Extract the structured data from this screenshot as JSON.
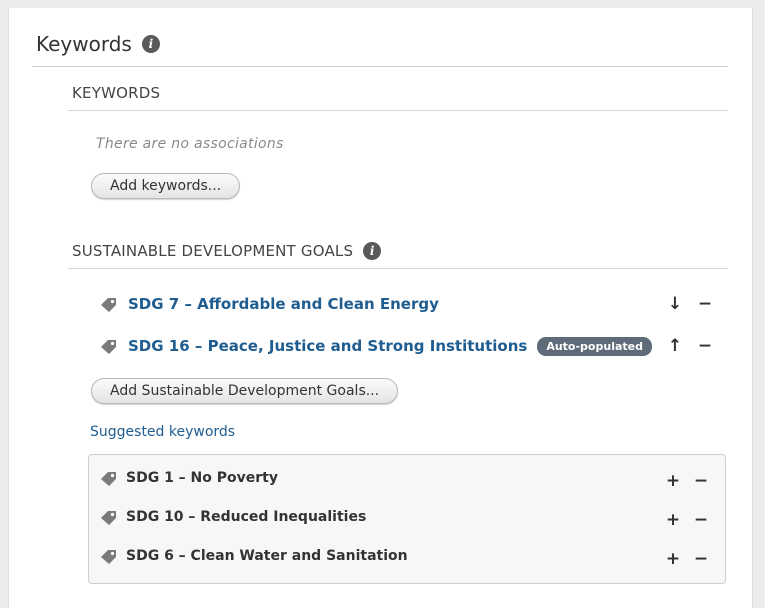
{
  "section": {
    "title": "Keywords",
    "info_icon": "info-icon"
  },
  "keywords": {
    "heading": "KEYWORDS",
    "empty_message": "There are no associations",
    "add_button": "Add keywords..."
  },
  "sdg": {
    "heading": "SUSTAINABLE DEVELOPMENT GOALS",
    "info_icon": "info-icon",
    "items": [
      {
        "label": "SDG 7 – Affordable and Clean Energy",
        "badge": "",
        "move_icon": "arrow-down-icon",
        "remove_icon": "minus-icon"
      },
      {
        "label": "SDG 16 – Peace, Justice and Strong Institutions",
        "badge": "Auto-populated",
        "move_icon": "arrow-up-icon",
        "remove_icon": "minus-icon"
      }
    ],
    "add_button": "Add Sustainable Development Goals..."
  },
  "suggested": {
    "label": "Suggested keywords",
    "items": [
      {
        "label": "SDG 1 – No Poverty",
        "add_icon": "plus-icon",
        "remove_icon": "minus-icon"
      },
      {
        "label": "SDG 10 – Reduced Inequalities",
        "add_icon": "plus-icon",
        "remove_icon": "minus-icon"
      },
      {
        "label": "SDG 6 – Clean Water and Sanitation",
        "add_icon": "plus-icon",
        "remove_icon": "minus-icon"
      }
    ]
  },
  "colors": {
    "link": "#1f5d91",
    "badge": "#5f6b79",
    "tag_icon": "#7a7a7a"
  }
}
